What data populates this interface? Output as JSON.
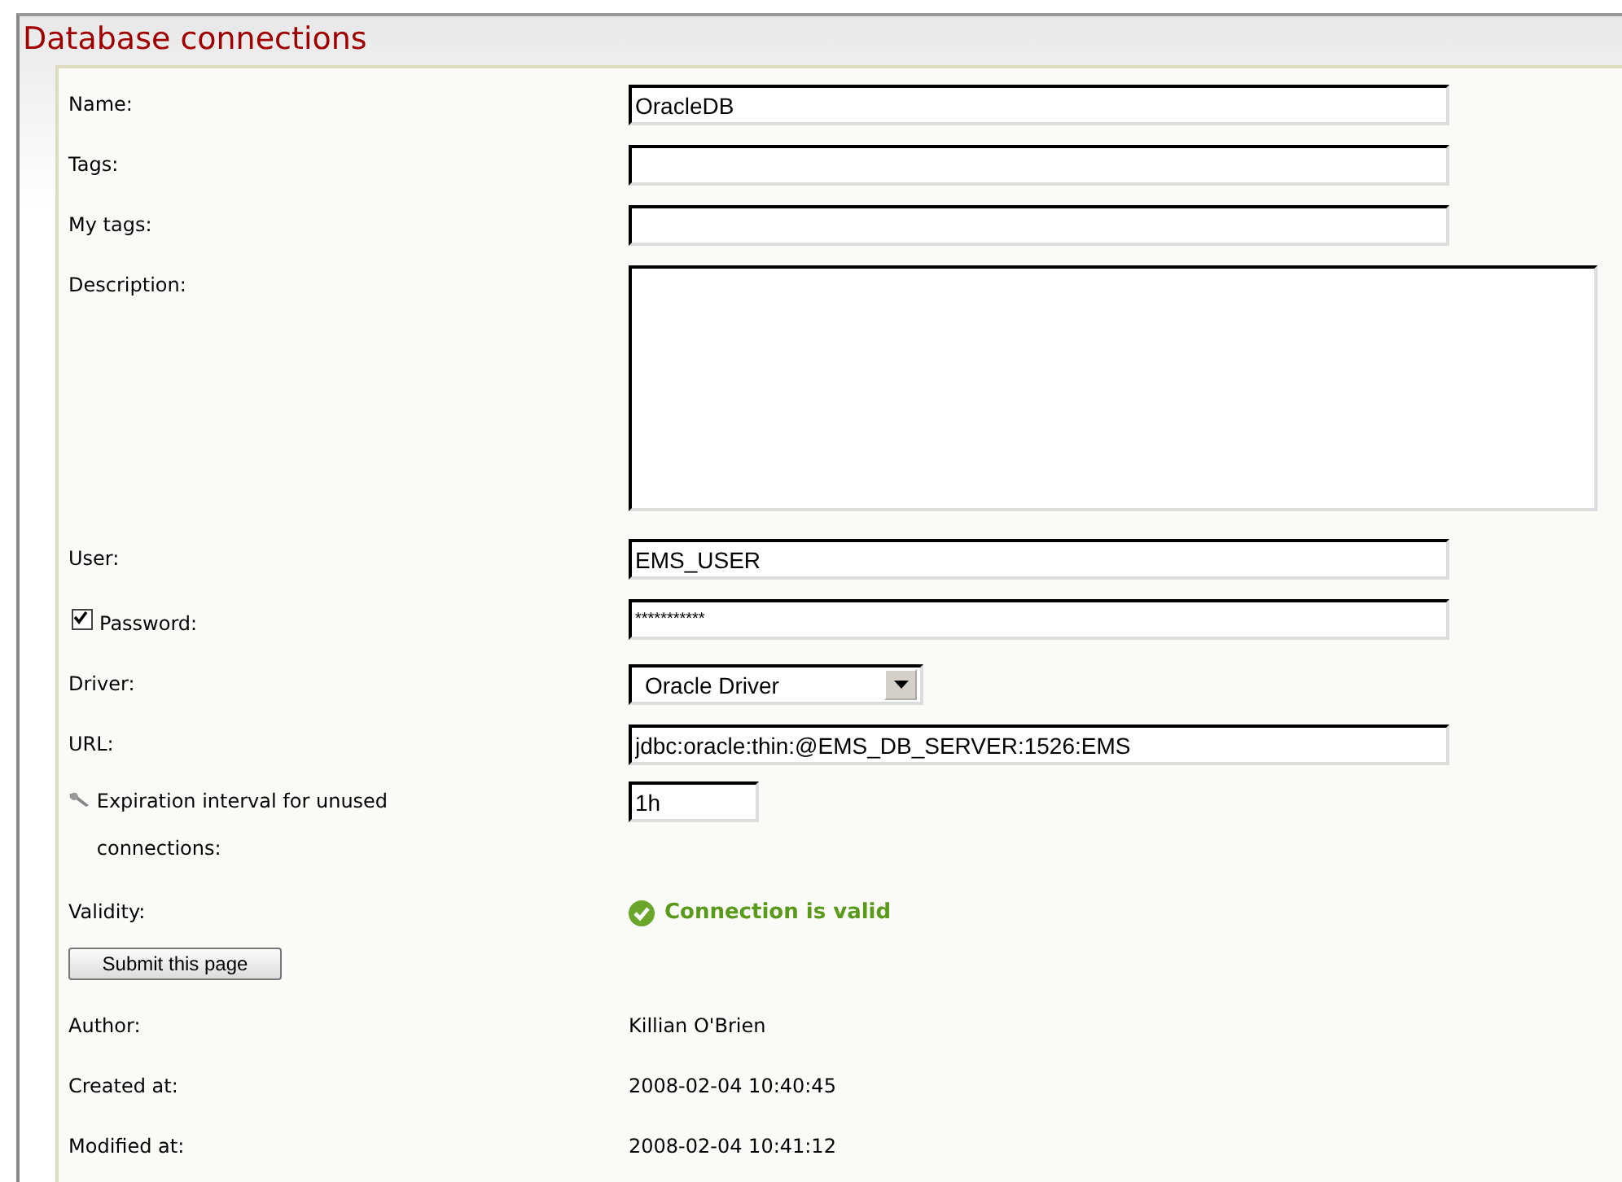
{
  "title": "Database connections",
  "fields": [
    {
      "kind": "text",
      "label": "Name:",
      "value": "OracleDB"
    },
    {
      "kind": "text",
      "label": "Tags:"
    },
    {
      "kind": "text",
      "label": "My tags:"
    },
    {
      "kind": "textarea",
      "label": "Description:"
    },
    {
      "kind": "text",
      "label": "User:",
      "value": "EMS_USER"
    },
    {
      "kind": "password",
      "label": "Password:",
      "checked": true,
      "value": "***********"
    },
    {
      "kind": "select",
      "label": "Driver:",
      "value": "Oracle Driver"
    },
    {
      "kind": "text",
      "label": "URL:",
      "value": "jdbc:oracle:thin:@EMS_DB_SERVER:1526:EMS"
    },
    {
      "kind": "short",
      "label": "Expiration interval for unused connections:",
      "value": "1h"
    },
    {
      "kind": "status",
      "label": "Validity:",
      "value": "Connection is valid"
    }
  ],
  "submit": "Submit this page",
  "info": [
    {
      "label": "Author:",
      "value": "Killian O'Brien"
    },
    {
      "label": "Created at:",
      "value": "2008-02-04 10:40:45"
    },
    {
      "label": "Modified at:",
      "value": "2008-02-04 10:41:12"
    }
  ]
}
